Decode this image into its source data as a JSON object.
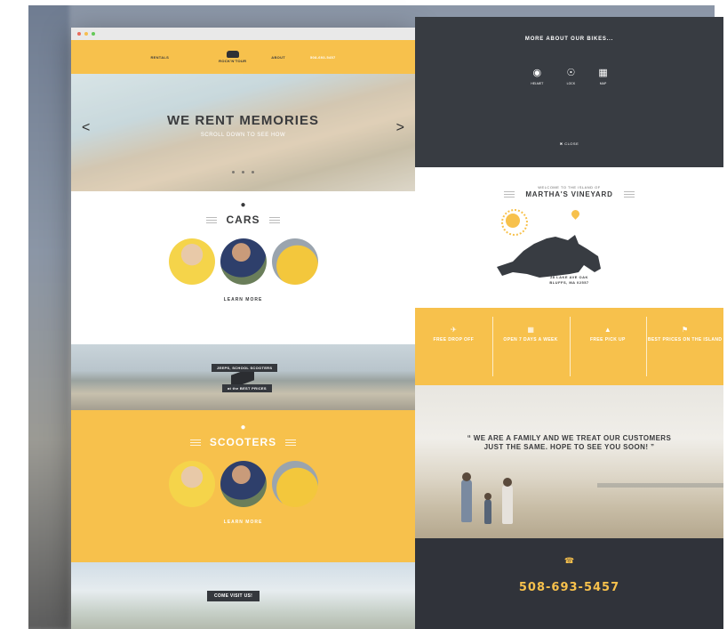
{
  "colors": {
    "accent": "#f7c14c",
    "dark": "#383c42",
    "text": "#3a3b3d"
  },
  "browser": {
    "dots": [
      "#e96b5c",
      "#f6be4f",
      "#64c958"
    ]
  },
  "left_page": {
    "nav": {
      "item1": "RENTALS",
      "item2": "",
      "logo": "ROCK'N'TOUR",
      "item3": "ABOUT",
      "item4": "508-693-5457"
    },
    "hero": {
      "title": "WE RENT MEMORIES",
      "subtitle": "SCROLL DOWN TO SEE HOW",
      "prev": "<",
      "next": ">"
    },
    "cars": {
      "title": "CARS",
      "description": "",
      "learn_more": "LEARN MORE"
    },
    "band1": {
      "ribbon_top": "JEEPS, SCHOOL SCOOTERS",
      "ribbon_bottom": "at the BEST PRICES"
    },
    "scooters": {
      "title": "SCOOTERS",
      "description": "",
      "learn_more": "LEARN MORE"
    },
    "band2": {
      "ribbon": "COME VISIT US!"
    }
  },
  "right_page": {
    "bikes": {
      "title": "MORE ABOUT OUR BIKES...",
      "subtitle": "",
      "icons": [
        {
          "icon": "helmet-icon",
          "label": "HELMET"
        },
        {
          "icon": "lock-icon",
          "label": "LOCK"
        },
        {
          "icon": "map-icon",
          "label": "MAP"
        }
      ],
      "paragraph": "",
      "close": "✖ CLOSE"
    },
    "island": {
      "welcome": "WELCOME TO THE ISLAND OF",
      "name": "MARTHA'S VINEYARD",
      "address_line1": "28 LAKE AVE OAK",
      "address_line2": "BLUFFS, MA 02557",
      "address_link": ""
    },
    "features": [
      {
        "icon": "plane-icon",
        "title": "FREE DROP OFF",
        "desc": ""
      },
      {
        "icon": "calendar-icon",
        "title": "OPEN 7 DAYS A WEEK",
        "desc": ""
      },
      {
        "icon": "pickup-icon",
        "title": "FREE PICK UP",
        "desc": ""
      },
      {
        "icon": "tag-icon",
        "title": "BEST PRICES ON THE ISLAND",
        "desc": ""
      }
    ],
    "testimonial": {
      "quote": "“ WE ARE A FAMILY AND WE TREAT OUR CUSTOMERS JUST THE SAME. HOPE TO SEE YOU SOON! ”",
      "author": ""
    },
    "contact": {
      "call_line": "",
      "phone": "508-693-5457",
      "email_line": ""
    }
  }
}
